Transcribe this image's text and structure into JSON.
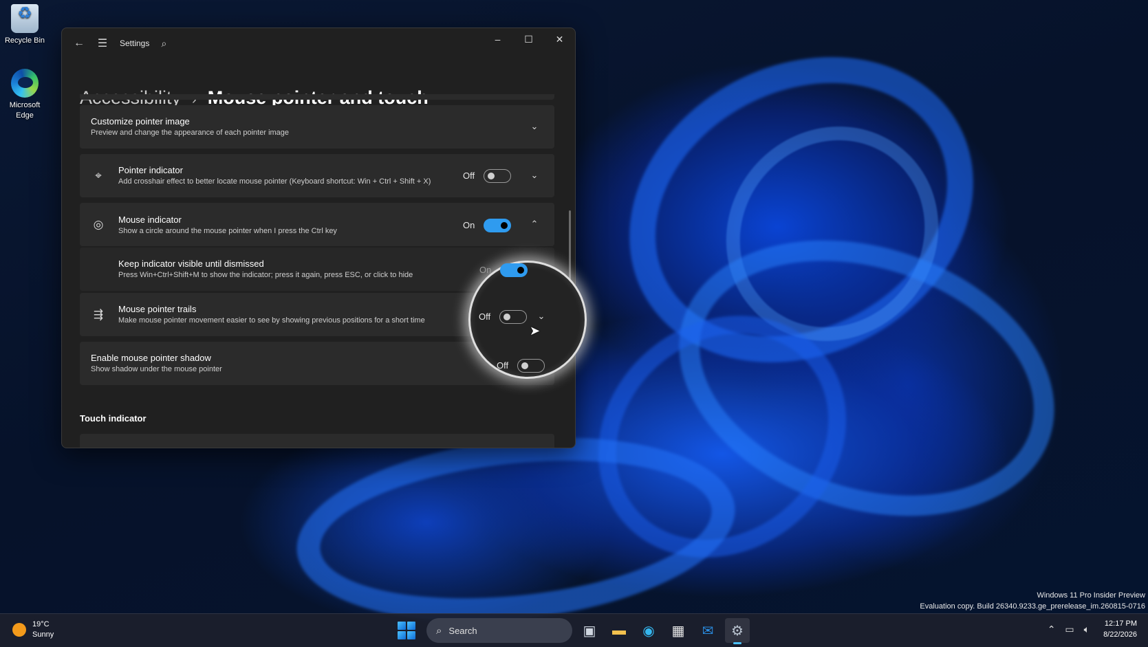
{
  "desktop": {
    "icons": [
      {
        "label": "Recycle Bin",
        "icon": "recycle-bin-icon"
      },
      {
        "label": "Microsoft\nEdge",
        "icon": "edge-icon"
      }
    ]
  },
  "window": {
    "app_title": "Settings",
    "breadcrumb": {
      "parent": "Accessibility",
      "separator": "›",
      "current": "Mouse pointer and touch"
    },
    "settings": [
      {
        "title": "Customize pointer image",
        "desc": "Preview and change the appearance of each pointer image"
      },
      {
        "title": "Pointer indicator",
        "desc": "Add crosshair effect to better locate mouse pointer (Keyboard shortcut: Win + Ctrl + Shift + X)",
        "state": "Off",
        "on": false
      },
      {
        "title": "Mouse indicator",
        "desc": "Show a circle around the mouse pointer when I press the Ctrl key",
        "state": "On",
        "on": true
      },
      {
        "title": "Keep indicator visible until dismissed",
        "desc": "Press Win+Ctrl+Shift+M to show the indicator; press it again, press ESC, or click to hide",
        "state": "On",
        "on": true
      },
      {
        "title": "Mouse pointer trails",
        "desc": "Make mouse pointer movement easier to see by showing previous positions for a short time",
        "state": "Off",
        "on": false
      },
      {
        "title": "Enable mouse pointer shadow",
        "desc": "Show shadow under the mouse pointer",
        "state": "Off",
        "on": false
      }
    ],
    "section_touch": "Touch indicator"
  },
  "watermark": {
    "line1": "Windows 11 Pro Insider Preview",
    "line2": "Evaluation copy. Build 26340.9233.ge_prerelease_im.260815-0716"
  },
  "taskbar": {
    "weather": {
      "temp": "19°C",
      "condition": "Sunny"
    },
    "search_label": "Search",
    "apps": [
      "task-view-icon",
      "file-explorer-icon",
      "edge-icon",
      "store-icon",
      "outlook-icon",
      "settings-icon"
    ],
    "clock": {
      "time": "12:17 PM",
      "date": "8/22/2026"
    }
  }
}
